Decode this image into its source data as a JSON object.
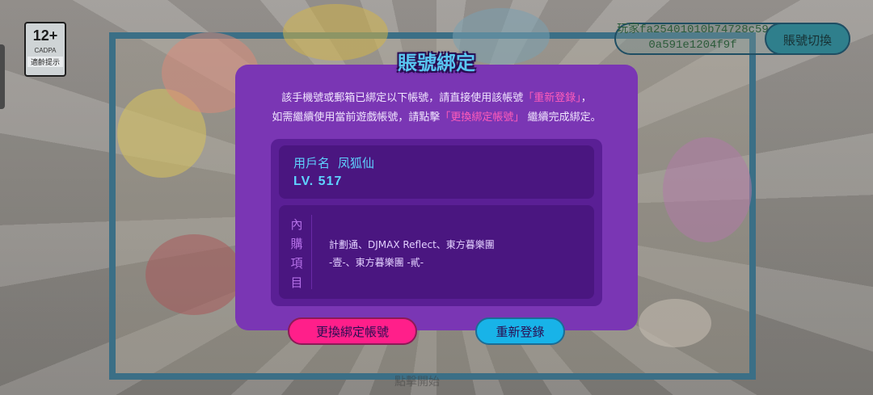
{
  "age_rating": {
    "value": "12+",
    "org": "CADPA",
    "label": "適齡提示"
  },
  "player": {
    "id": "玩家fa25401010b74728c590a591e1204f9f",
    "switch_label": "賬號切換"
  },
  "bottom_hint": "點擊開始",
  "dialog": {
    "title": "賬號綁定",
    "msg_line1_prefix": "該手機號或郵箱已綁定以下帳號，請直接使用該帳號",
    "msg_line1_highlight": "「重新登錄」",
    "msg_line1_suffix": "，",
    "msg_line2_prefix": "如需繼續使用當前遊戲帳號，請點擊",
    "msg_line2_highlight": "「更換綁定帳號」",
    "msg_line2_suffix": " 繼續完成綁定。",
    "username_label": "用戶名",
    "username_value": "凤狐仙",
    "level": "LV. 517",
    "purchases_label": "內購項目",
    "purchases_line1": "計劃通、DJMAX Reflect、東方暮樂團",
    "purchases_line2": "-壹-、東方暮樂團 -貳-",
    "change_binding_button": "更換綁定帳號",
    "relogin_button": "重新登錄"
  },
  "colors": {
    "dialog_bg": "#7a36b4",
    "title": "#59c7f1",
    "highlight": "#ff5cba",
    "change_button": "#ff1f8a",
    "relogin_button": "#18b3e8"
  }
}
